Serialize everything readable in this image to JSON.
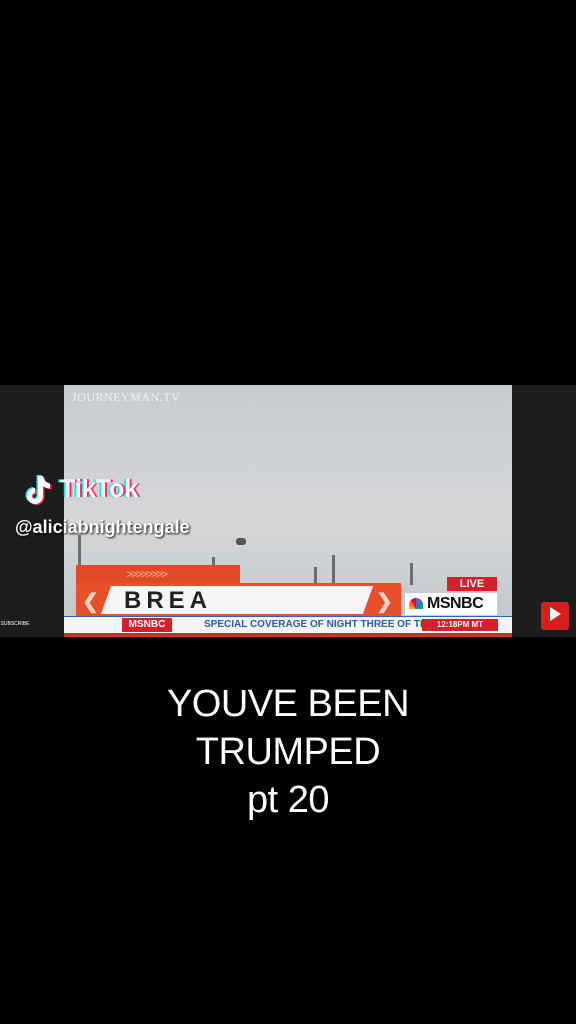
{
  "tiktok": {
    "brand": "TikTok",
    "handle": "@aliciabnightengale"
  },
  "video": {
    "watermark": "JOURNEYMAN.TV",
    "banner_text": "BREA",
    "live_label": "LIVE",
    "network": "MSNBC",
    "ticker": {
      "label": "MSNBC",
      "text": "SPECIAL COVERAGE OF NIGHT THREE OF THE",
      "time": "12:18PM MT"
    },
    "subscribe_label": "SUBSCRIBE"
  },
  "caption": {
    "line1": "YOUVE BEEN",
    "line2": "TRUMPED",
    "line3": "pt 20"
  },
  "colors": {
    "background": "#000000",
    "banner_orange": "#e8502a",
    "msnbc_red": "#d3202a",
    "ticker_blue": "#2a5db0"
  }
}
